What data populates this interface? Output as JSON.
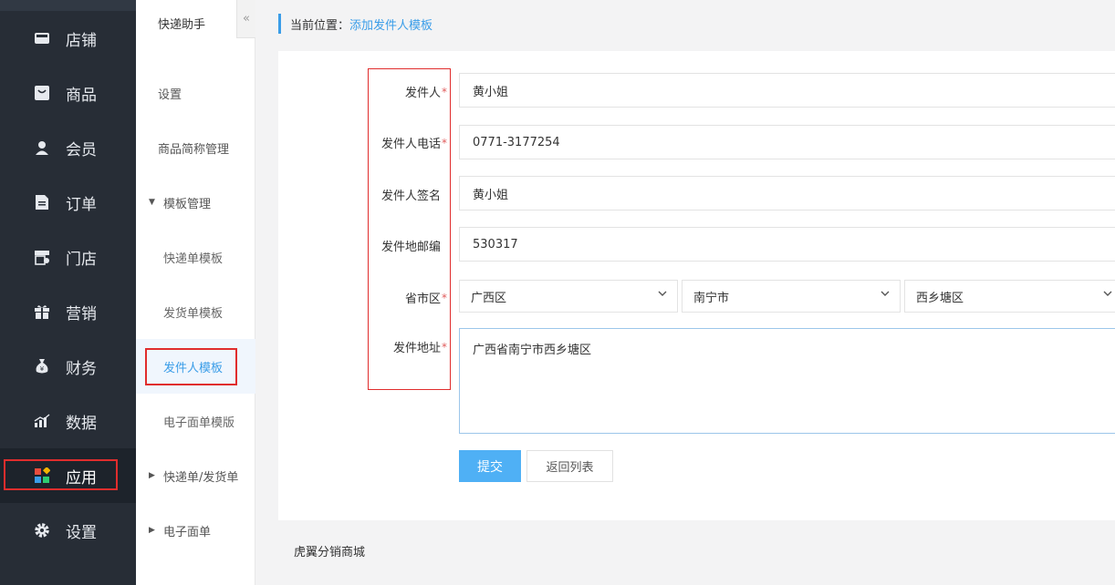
{
  "nav": {
    "items": [
      {
        "label": "店铺",
        "icon": "store-icon"
      },
      {
        "label": "商品",
        "icon": "bag-icon"
      },
      {
        "label": "会员",
        "icon": "user-icon"
      },
      {
        "label": "订单",
        "icon": "document-icon"
      },
      {
        "label": "门店",
        "icon": "shop-icon"
      },
      {
        "label": "营销",
        "icon": "gift-icon"
      },
      {
        "label": "财务",
        "icon": "money-bag-icon"
      },
      {
        "label": "数据",
        "icon": "bar-chart-icon"
      },
      {
        "label": "应用",
        "icon": "apps-grid-icon"
      },
      {
        "label": "设置",
        "icon": "gear-icon"
      }
    ],
    "active": "应用"
  },
  "submenu": {
    "title": "快递助手",
    "collapse_glyph": "«",
    "items": [
      {
        "label": "设置"
      },
      {
        "label": "商品简称管理"
      },
      {
        "label": "模板管理",
        "caret": "▼"
      },
      {
        "label": "快递单模板"
      },
      {
        "label": "发货单模板"
      },
      {
        "label": "发件人模板"
      },
      {
        "label": "电子面单模版"
      },
      {
        "label": "快递单/发货单",
        "caret": "▶"
      },
      {
        "label": "电子面单",
        "caret": "▶"
      }
    ],
    "current": "发件人模板"
  },
  "breadcrumb": {
    "prefix": "当前位置：",
    "current": "添加发件人模板"
  },
  "form": {
    "required_mark": "*",
    "sender_name": {
      "label": "发件人",
      "value": "黄小姐"
    },
    "sender_phone": {
      "label": "发件人电话",
      "value": "0771-3177254"
    },
    "sender_signature": {
      "label": "发件人签名",
      "value": "黄小姐"
    },
    "postal_code": {
      "label": "发件地邮编",
      "value": "530317"
    },
    "region": {
      "label": "省市区",
      "province": "广西区",
      "city": "南宁市",
      "district": "西乡塘区"
    },
    "address": {
      "label": "发件地址",
      "value": "广西省南宁市西乡塘区"
    },
    "submit_label": "提交",
    "back_label": "返回列表"
  },
  "footer": {
    "text": "虎翼分销商城"
  },
  "colors": {
    "accent": "#3a9de8",
    "nav_bg": "#272d36",
    "highlight": "#e02d2d"
  }
}
